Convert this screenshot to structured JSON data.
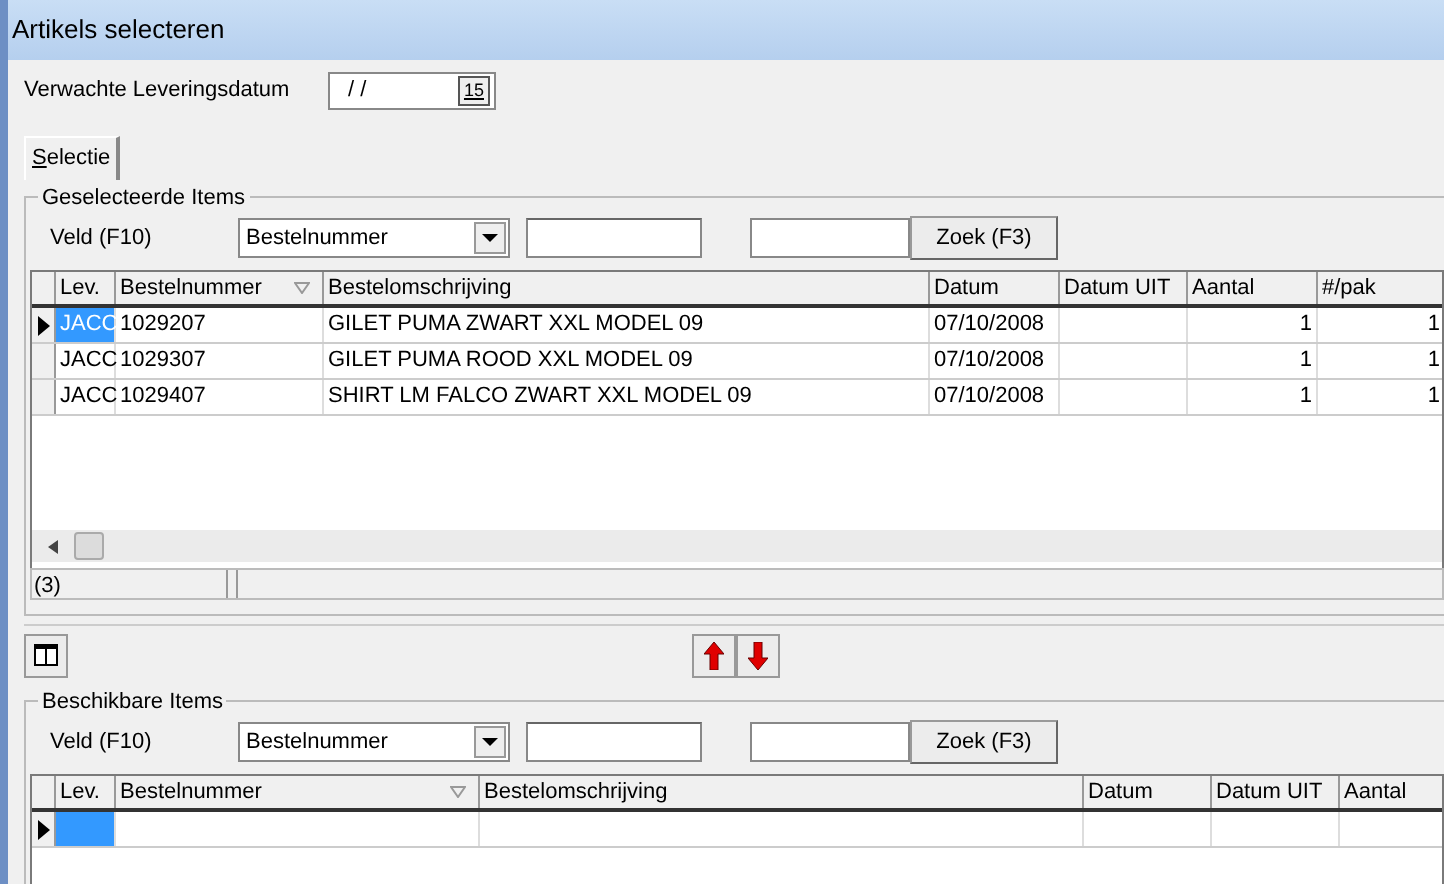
{
  "window": {
    "title": "Artikels selecteren"
  },
  "delivery_date": {
    "label": "Verwachte Leveringsdatum",
    "value": " / /",
    "calendar_button": "15"
  },
  "tabs": [
    {
      "label": "Selectie",
      "selected": true
    }
  ],
  "selected_items": {
    "title": "Geselecteerde Items",
    "field_label": "Veld (F10)",
    "field_value": "Bestelnummer",
    "search_button": "Zoek (F3)",
    "columns": [
      {
        "label": "Lev.",
        "sorted": false
      },
      {
        "label": "Bestelnummer",
        "sorted": true
      },
      {
        "label": "Bestelomschrijving",
        "sorted": false
      },
      {
        "label": "Datum",
        "sorted": false
      },
      {
        "label": "Datum UIT",
        "sorted": false
      },
      {
        "label": "Aantal",
        "sorted": false
      },
      {
        "label": "#/pak",
        "sorted": false
      }
    ],
    "rows": [
      {
        "selected": true,
        "cells": [
          "JACC",
          "1029207",
          "GILET PUMA ZWART XXL MODEL 09",
          "07/10/2008",
          "",
          "1",
          "1"
        ]
      },
      {
        "selected": false,
        "cells": [
          "JACC",
          "1029307",
          "GILET PUMA ROOD XXL MODEL 09",
          "07/10/2008",
          "",
          "1",
          "1"
        ]
      },
      {
        "selected": false,
        "cells": [
          "JACC",
          "1029407",
          "SHIRT LM FALCO ZWART XXL MODEL 09",
          "07/10/2008",
          "",
          "1",
          "1"
        ]
      }
    ],
    "status": "(3)"
  },
  "available_items": {
    "title": "Beschikbare Items",
    "field_label": "Veld (F10)",
    "field_value": "Bestelnummer",
    "search_button": "Zoek (F3)",
    "columns": [
      {
        "label": "Lev.",
        "sorted": false
      },
      {
        "label": "Bestelnummer",
        "sorted": true
      },
      {
        "label": "Bestelomschrijving",
        "sorted": false
      },
      {
        "label": "Datum",
        "sorted": false
      },
      {
        "label": "Datum UIT",
        "sorted": false
      },
      {
        "label": "Aantal",
        "sorted": false
      }
    ],
    "rows": [
      {
        "selected": true,
        "cells": [
          "",
          "",
          "",
          "",
          "",
          ""
        ]
      }
    ]
  }
}
